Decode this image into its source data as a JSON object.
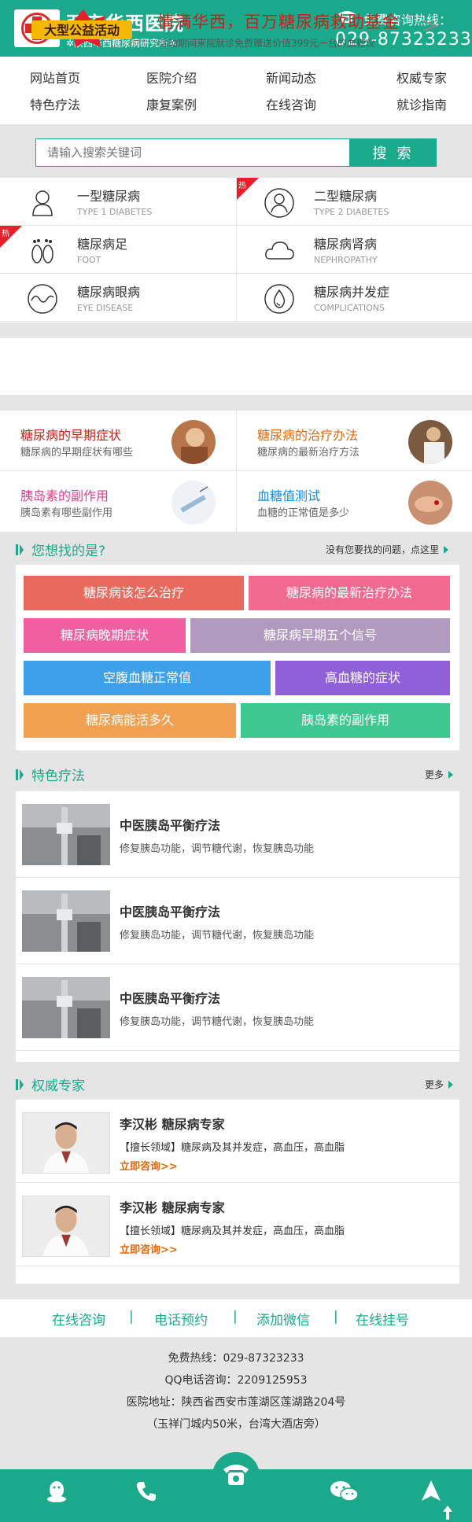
{
  "header": {
    "brand_name": "西安华西医院",
    "brand_sub": "✲陕西华西糖尿病研究所✲",
    "hotline_label": "免费咨询热线：",
    "hotline_number": "029-87323233"
  },
  "nav": [
    "网站首页",
    "医院介绍",
    "新闻动态",
    "权威专家",
    "特色疗法",
    "康复案例",
    "在线咨询",
    "就诊指南"
  ],
  "search": {
    "placeholder": "请输入搜索关键词",
    "button": "搜 索"
  },
  "categories": [
    {
      "title": "一型糖尿病",
      "en": "TYPE 1 DIABETES",
      "icon": "person-icon",
      "hot": false
    },
    {
      "title": "二型糖尿病",
      "en": "TYPE 2 DIABETES",
      "icon": "person-circle-icon",
      "hot": true
    },
    {
      "title": "糖尿病足",
      "en": "FOOT",
      "icon": "footprint-icon",
      "hot": true
    },
    {
      "title": "糖尿病肾病",
      "en": "NEPHROPATHY",
      "icon": "cloud-icon",
      "hot": false
    },
    {
      "title": "糖尿病眼病",
      "en": "EYE DISEASE",
      "icon": "wave-circle-icon",
      "hot": false
    },
    {
      "title": "糖尿病并发症",
      "en": "COMPLICATIONS",
      "icon": "drop-circle-icon",
      "hot": false
    }
  ],
  "hot_label": "热",
  "banner": {
    "art_text": "大型公益活动",
    "title": "情满华西，百万糖尿病救助基金",
    "desc": "活动期间来院就诊免费赠送价值399元一台的血糖仪",
    "arrow": ">"
  },
  "articles": [
    {
      "title": "糖尿病的早期症状",
      "desc": "糖尿病的早期症状有哪些",
      "color": "#c0241a"
    },
    {
      "title": "糖尿病的治疗办法",
      "desc": "糖尿病的最新治疗方法",
      "color": "#e06a10"
    },
    {
      "title": "胰岛素的副作用",
      "desc": "胰岛素有哪些副作用",
      "color": "#e0408a"
    },
    {
      "title": "血糖值测试",
      "desc": "血糖的正常值是多少",
      "color": "#1a8ad6"
    }
  ],
  "find": {
    "title": "您想找的是?",
    "right": "没有您要找的问题，点这里"
  },
  "tags": [
    {
      "text": "糖尿病该怎么治疗",
      "color": "#e86a5e"
    },
    {
      "text": "糖尿病的最新治疗办法",
      "color": "#f06a90"
    },
    {
      "text": "糖尿病晚期症状",
      "color": "#f060a0"
    },
    {
      "text": "糖尿病早期五个信号",
      "color": "#b09ac0"
    },
    {
      "text": "空腹血糖正常值",
      "color": "#3da0e8"
    },
    {
      "text": "高血糖的症状",
      "color": "#9060d8"
    },
    {
      "text": "糖尿病能活多久",
      "color": "#f0a050"
    },
    {
      "text": "胰岛素的副作用",
      "color": "#3cc890"
    }
  ],
  "therapy": {
    "title": "特色疗法",
    "more": "更多",
    "items": [
      {
        "title": "中医胰岛平衡疗法",
        "desc": "修复胰岛功能，调节糖代谢，恢复胰岛功能"
      },
      {
        "title": "中医胰岛平衡疗法",
        "desc": "修复胰岛功能，调节糖代谢，恢复胰岛功能"
      },
      {
        "title": "中医胰岛平衡疗法",
        "desc": "修复胰岛功能，调节糖代谢，恢复胰岛功能"
      }
    ]
  },
  "experts": {
    "title": "权威专家",
    "more": "更多",
    "items": [
      {
        "name": "李汉彬  糖尿病专家",
        "desc": "【擅长领域】糖尿病及其并发症，高血压，高血脂",
        "link": "立即咨询>>"
      },
      {
        "name": "李汉彬  糖尿病专家",
        "desc": "【擅长领域】糖尿病及其并发症，高血压，高血脂",
        "link": "立即咨询>>"
      }
    ]
  },
  "footer_links": [
    "在线咨询",
    "电话预约",
    "添加微信",
    "在线挂号"
  ],
  "footer_sep": "|",
  "footer_info": [
    "免费热线：029-87323233",
    "QQ电话咨询：2209125953",
    "医院地址：陕西省西安市莲湖区莲湖路204号",
    "（玉祥门城内50米，台湾大酒店旁）"
  ],
  "colors": {
    "accent": "#1aaa8b",
    "hot": "#e81e2a",
    "banner_title": "#c0241a",
    "link": "#e06a10"
  }
}
